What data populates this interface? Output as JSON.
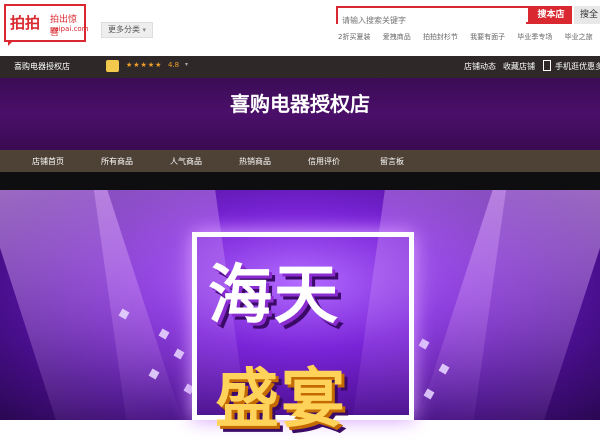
{
  "header": {
    "logo_big": "拍拍",
    "logo_small1": "拍出惊喜",
    "logo_small2": "paipai.com",
    "more_categories": "更多分类",
    "search_placeholder": "请输入搜索关键字",
    "search_store_button": "搜本店",
    "search_all_button": "搜全",
    "hot_links": [
      "2折买夏装",
      "爱拽商品",
      "拍拍封杉节",
      "我要有面子",
      "毕业季专场",
      "毕业之旅"
    ]
  },
  "store_bar": {
    "store_name": "喜购电器授权店",
    "stars": "★★★★★",
    "rating": "4.8",
    "store_news": "店铺动态",
    "favorite_store": "收藏店铺",
    "mobile_offer": "手机逛优惠多"
  },
  "banner": {
    "store_title": "喜购电器授权店"
  },
  "nav": {
    "items": [
      "店铺首页",
      "所有商品",
      "人气商品",
      "热销商品",
      "信用评价",
      "留言板"
    ]
  },
  "hero": {
    "word1": "海天",
    "word2": "盛宴"
  },
  "colors": {
    "brand_red": "#d9282f",
    "purple_band": "#4b0f6a",
    "nav_brown": "#4e4237"
  }
}
